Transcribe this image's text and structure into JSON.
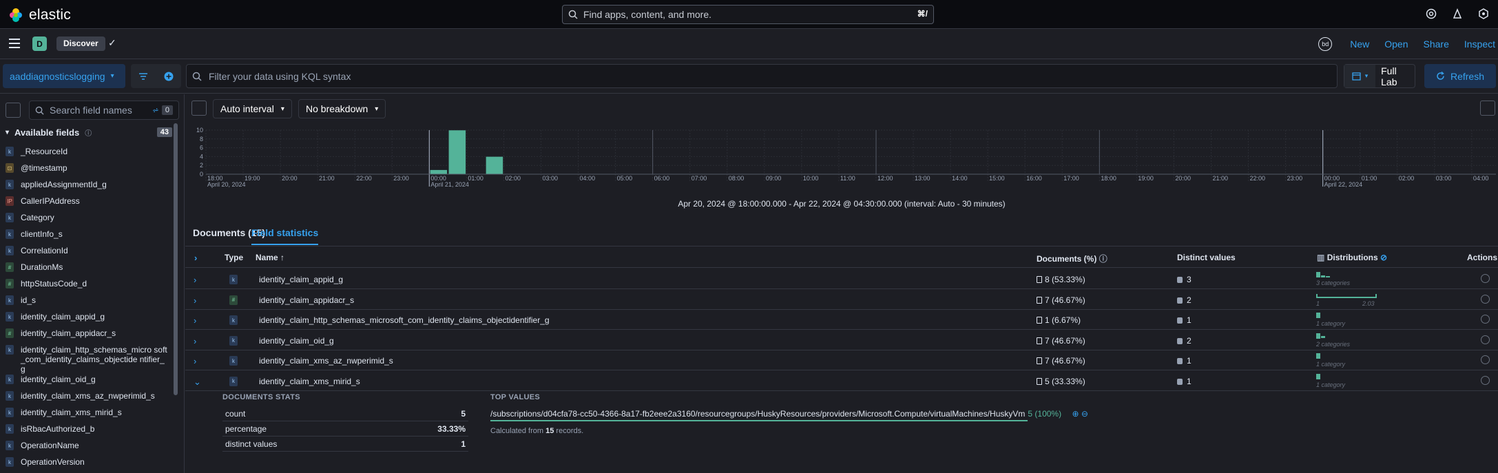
{
  "brand": {
    "name": "elastic"
  },
  "global_search": {
    "placeholder": "Find apps, content, and more.",
    "shortcut": "⌘/"
  },
  "header": {
    "space_initial": "D",
    "breadcrumb": "Discover",
    "user_initials": "bd",
    "actions": [
      "New",
      "Open",
      "Share",
      "Inspect"
    ]
  },
  "query_bar": {
    "data_view": "aaddiagnosticslogging",
    "kql_placeholder": "Filter your data using KQL syntax",
    "date_label": "Full Lab",
    "refresh_label": "Refresh"
  },
  "sidebar": {
    "search_placeholder": "Search field names",
    "filter_count": "0",
    "available_label": "Available fields",
    "available_count": "43",
    "fields": [
      {
        "name": "_ResourceId",
        "type": "k"
      },
      {
        "name": "@timestamp",
        "type": "d"
      },
      {
        "name": "appliedAssignmentId_g",
        "type": "k"
      },
      {
        "name": "CallerIPAddress",
        "type": "ip"
      },
      {
        "name": "Category",
        "type": "k"
      },
      {
        "name": "clientInfo_s",
        "type": "k"
      },
      {
        "name": "CorrelationId",
        "type": "k"
      },
      {
        "name": "DurationMs",
        "type": "n"
      },
      {
        "name": "httpStatusCode_d",
        "type": "n"
      },
      {
        "name": "id_s",
        "type": "k"
      },
      {
        "name": "identity_claim_appid_g",
        "type": "k"
      },
      {
        "name": "identity_claim_appidacr_s",
        "type": "n"
      },
      {
        "name": "identity_claim_http_schemas_microsoft_com_identity_claims_objectidentifier_g",
        "type": "k",
        "display": "identity_claim_http_schemas_micro soft_com_identity_claims_objectide ntifier_g"
      },
      {
        "name": "identity_claim_oid_g",
        "type": "k"
      },
      {
        "name": "identity_claim_xms_az_nwperimid_s",
        "type": "k"
      },
      {
        "name": "identity_claim_xms_mirid_s",
        "type": "k"
      },
      {
        "name": "isRbacAuthorized_b",
        "type": "k"
      },
      {
        "name": "OperationName",
        "type": "k"
      },
      {
        "name": "OperationVersion",
        "type": "k"
      }
    ]
  },
  "histogram": {
    "interval_label": "Auto interval",
    "breakdown_label": "No breakdown",
    "time_range": "Apr 20, 2024 @ 18:00:00.000 - Apr 22, 2024 @ 04:30:00.000 (interval: Auto - 30 minutes)",
    "y_ticks": [
      "10",
      "8",
      "6",
      "4",
      "2",
      "0"
    ],
    "x_ticks": [
      "18:00",
      "19:00",
      "20:00",
      "21:00",
      "22:00",
      "23:00",
      "00:00",
      "01:00",
      "02:00",
      "03:00",
      "04:00",
      "05:00",
      "06:00",
      "07:00",
      "08:00",
      "09:00",
      "10:00",
      "11:00",
      "12:00",
      "13:00",
      "14:00",
      "15:00",
      "16:00",
      "17:00",
      "18:00",
      "19:00",
      "20:00",
      "21:00",
      "22:00",
      "23:00",
      "00:00",
      "01:00",
      "02:00",
      "03:00",
      "04:00"
    ],
    "date_labels": [
      {
        "at": 0,
        "text": "April 20, 2024"
      },
      {
        "at": 6,
        "text": "April 21, 2024"
      },
      {
        "at": 30,
        "text": "April 22, 2024"
      }
    ]
  },
  "chart_data": {
    "type": "bar",
    "title": "",
    "xlabel": "",
    "ylabel": "",
    "ylim": [
      0,
      10
    ],
    "categories": [
      "00:00",
      "00:30",
      "01:30"
    ],
    "values": [
      1,
      10,
      4
    ],
    "color": "#54b399"
  },
  "tabs": {
    "documents": "Documents (15)",
    "field_stats": "Field statistics"
  },
  "table": {
    "headers": {
      "type": "Type",
      "name": "Name",
      "documents": "Documents (%)",
      "distinct": "Distinct values",
      "distributions": "Distributions",
      "actions": "Actions"
    },
    "rows": [
      {
        "type": "k",
        "name": "identity_claim_appid_g",
        "docs": "8 (53.33%)",
        "distinct": "3",
        "dist_label": "3 categories"
      },
      {
        "type": "n",
        "name": "identity_claim_appidacr_s",
        "docs": "7 (46.67%)",
        "distinct": "2",
        "dist_min": "1",
        "dist_max": "2.03"
      },
      {
        "type": "k",
        "name": "identity_claim_http_schemas_microsoft_com_identity_claims_objectidentifier_g",
        "docs": "1 (6.67%)",
        "distinct": "1",
        "dist_label": "1 category"
      },
      {
        "type": "k",
        "name": "identity_claim_oid_g",
        "docs": "7 (46.67%)",
        "distinct": "2",
        "dist_label": "2 categories"
      },
      {
        "type": "k",
        "name": "identity_claim_xms_az_nwperimid_s",
        "docs": "7 (46.67%)",
        "distinct": "1",
        "dist_label": "1 category"
      },
      {
        "type": "k",
        "name": "identity_claim_xms_mirid_s",
        "docs": "5 (33.33%)",
        "distinct": "1",
        "dist_label": "1 category"
      }
    ]
  },
  "expanded": {
    "stats_title": "DOCUMENTS STATS",
    "stats": [
      {
        "label": "count",
        "value": "5"
      },
      {
        "label": "percentage",
        "value": "33.33%"
      },
      {
        "label": "distinct values",
        "value": "1"
      }
    ],
    "top_values_title": "TOP VALUES",
    "top_value": "/subscriptions/d04cfa78-cc50-4366-8a17-fb2eee2a3160/resourcegroups/HuskyResources/providers/Microsoft.Compute/virtualMachines/HuskyVm",
    "top_value_pct": "5 (100%)",
    "calc_prefix": "Calculated from",
    "calc_count": "15",
    "calc_suffix": "records."
  }
}
